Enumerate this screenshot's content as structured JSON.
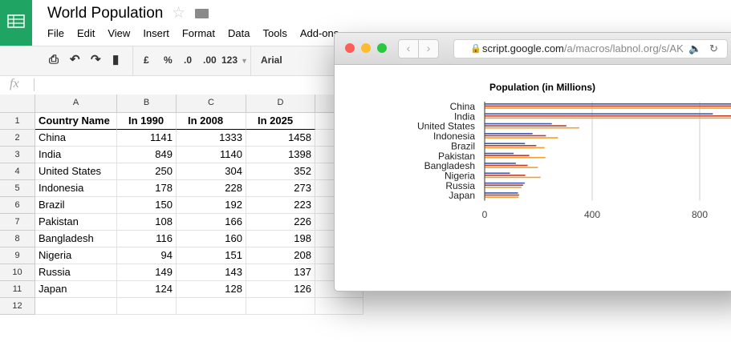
{
  "sheet": {
    "title": "World Population",
    "menu": [
      "File",
      "Edit",
      "View",
      "Insert",
      "Format",
      "Data",
      "Tools",
      "Add-ons"
    ],
    "toolbar": {
      "currency": "£",
      "percent": "%",
      "dec_less": ".0",
      "dec_more": ".00",
      "format": "123",
      "font": "Arial"
    },
    "formula_label": "fx",
    "columns": [
      "A",
      "B",
      "C",
      "D"
    ],
    "rows": [
      [
        "Country Name",
        "In 1990",
        "In 2008",
        "In 2025"
      ],
      [
        "China",
        "1141",
        "1333",
        "1458"
      ],
      [
        "India",
        "849",
        "1140",
        "1398"
      ],
      [
        "United States",
        "250",
        "304",
        "352"
      ],
      [
        "Indonesia",
        "178",
        "228",
        "273"
      ],
      [
        "Brazil",
        "150",
        "192",
        "223"
      ],
      [
        "Pakistan",
        "108",
        "166",
        "226"
      ],
      [
        "Bangladesh",
        "116",
        "160",
        "198"
      ],
      [
        "Nigeria",
        "94",
        "151",
        "208"
      ],
      [
        "Russia",
        "149",
        "143",
        "137"
      ],
      [
        "Japan",
        "124",
        "128",
        "126"
      ],
      [
        "",
        "",
        "",
        ""
      ]
    ]
  },
  "browser": {
    "url_host": "script.google.com",
    "url_path": "/a/macros/labnol.org/s/AK"
  },
  "colors": {
    "sheets_green": "#1fa463",
    "series": [
      "#3b5ba8",
      "#c0392b",
      "#f0a030"
    ]
  },
  "chart_data": {
    "type": "bar",
    "orientation": "horizontal",
    "title": "Population (in Millions)",
    "categories": [
      "China",
      "India",
      "United States",
      "Indonesia",
      "Brazil",
      "Pakistan",
      "Bangladesh",
      "Nigeria",
      "Russia",
      "Japan"
    ],
    "series": [
      {
        "values": [
          1141,
          849,
          250,
          178,
          150,
          108,
          116,
          94,
          149,
          124
        ]
      },
      {
        "values": [
          1333,
          1140,
          304,
          228,
          192,
          166,
          160,
          151,
          143,
          128
        ]
      },
      {
        "values": [
          1458,
          1398,
          352,
          273,
          223,
          226,
          198,
          208,
          137,
          126
        ]
      }
    ],
    "xticks": [
      "0",
      "400",
      "800"
    ],
    "xlim": [
      0,
      1600
    ],
    "grid": true,
    "legend": "none"
  }
}
